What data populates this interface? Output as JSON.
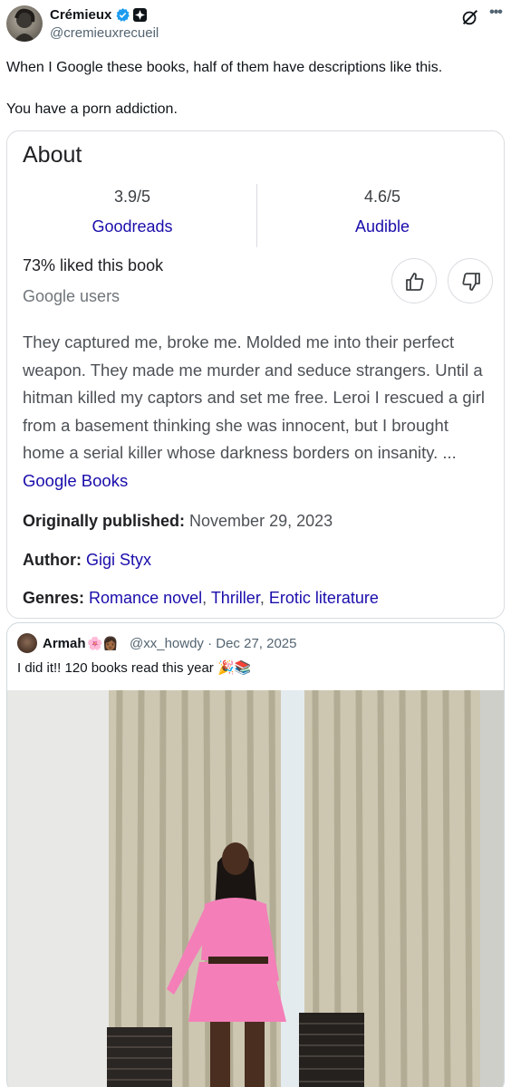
{
  "post": {
    "author_name": "Crémieux",
    "author_handle": "@cremieuxrecueil",
    "line1": "When I Google these books, half of them have descriptions like this.",
    "line2": "You have a porn addiction."
  },
  "about_card": {
    "title": "About",
    "ratings": [
      {
        "score": "3.9/5",
        "source": "Goodreads"
      },
      {
        "score": "4.6/5",
        "source": "Audible"
      }
    ],
    "liked": "73% liked this book",
    "liked_by": "Google users",
    "description": "They captured me, broke me. Molded me into their perfect weapon. They made me murder and seduce strangers. Until a hitman killed my captors and set me free. Leroi I rescued a girl from a basement thinking she was innocent, but I brought home a serial killer whose darkness borders on insanity. ...",
    "description_link": "Google Books",
    "published_label": "Originally published:",
    "published_value": "November 29, 2023",
    "author_label": "Author:",
    "author_value": "Gigi Styx",
    "genres_label": "Genres:",
    "genres": [
      "Romance novel",
      "Thriller",
      "Erotic literature"
    ]
  },
  "quoted": {
    "name": "Armah",
    "name_emoji": "🌸👩🏾",
    "handle_date": "@xx_howdy · Dec 27, 2025",
    "text": "I did it!! 120 books read this year 🎉📚"
  },
  "colors": {
    "link_blue": "#1a0dab",
    "verified_blue": "#1d9bf0",
    "outfit_pink": "#f47eb8"
  }
}
